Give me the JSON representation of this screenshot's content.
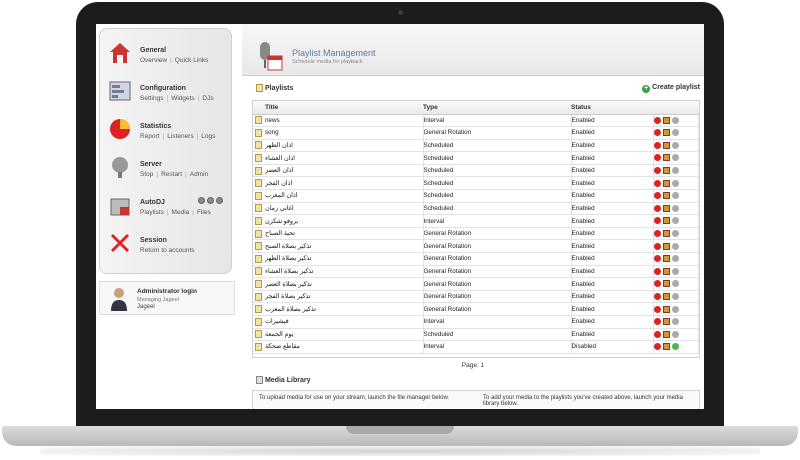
{
  "sidebar": {
    "items": [
      {
        "title": "General",
        "links": [
          "Overview",
          "Quick Links"
        ],
        "icon": "house-icon"
      },
      {
        "title": "Configuration",
        "links": [
          "Settings",
          "Widgets",
          "DJs"
        ],
        "icon": "config-panel-icon"
      },
      {
        "title": "Statistics",
        "links": [
          "Report",
          "Listeners",
          "Logs"
        ],
        "icon": "pie-chart-icon"
      },
      {
        "title": "Server",
        "links": [
          "Stop",
          "Restart",
          "Admin"
        ],
        "icon": "server-icon"
      },
      {
        "title": "AutoDJ",
        "links": [
          "Playlists",
          "Media",
          "Files"
        ],
        "icon": "autodj-icon"
      },
      {
        "title": "Session",
        "links": [
          "Return to accounts"
        ],
        "icon": "close-x-icon"
      }
    ]
  },
  "admin": {
    "title": "Administrator login",
    "subtitle": "Managing Jageel",
    "name": "Jageel"
  },
  "header": {
    "title": "Playlist Management",
    "subtitle": "Schedule media for playback"
  },
  "playlists": {
    "section_title": "Playlists",
    "create_label": "Create playlist",
    "columns": {
      "title": "Title",
      "type": "Type",
      "status": "Status"
    },
    "rows": [
      {
        "title": "news",
        "type": "Interval",
        "status": "Enabled"
      },
      {
        "title": "song",
        "type": "General Rotation",
        "status": "Enabled"
      },
      {
        "title": "اذان الظهر",
        "type": "Scheduled",
        "status": "Enabled"
      },
      {
        "title": "اذان العشاء",
        "type": "Scheduled",
        "status": "Enabled"
      },
      {
        "title": "اذان العصر",
        "type": "Scheduled",
        "status": "Enabled"
      },
      {
        "title": "اذان الفجر",
        "type": "Scheduled",
        "status": "Enabled"
      },
      {
        "title": "اذان المغرب",
        "type": "Scheduled",
        "status": "Enabled"
      },
      {
        "title": "اغاني زمان",
        "type": "Scheduled",
        "status": "Enabled"
      },
      {
        "title": "بروفو شكرن",
        "type": "Interval",
        "status": "Enabled"
      },
      {
        "title": "تحية الصباح",
        "type": "General Rotation",
        "status": "Enabled"
      },
      {
        "title": "تذكير بصلاة الصبح",
        "type": "General Rotation",
        "status": "Enabled"
      },
      {
        "title": "تذكير بصلاة الظهر",
        "type": "General Rotation",
        "status": "Enabled"
      },
      {
        "title": "تذكير بصلاة العشاء",
        "type": "General Rotation",
        "status": "Enabled"
      },
      {
        "title": "تذكير بصلاة العصر",
        "type": "General Rotation",
        "status": "Enabled"
      },
      {
        "title": "تذكير بصلاة الفجر",
        "type": "General Rotation",
        "status": "Enabled"
      },
      {
        "title": "تذكير بصلاة المغرب",
        "type": "General Rotation",
        "status": "Enabled"
      },
      {
        "title": "فيشيرات",
        "type": "Interval",
        "status": "Enabled"
      },
      {
        "title": "يوم الجمعة",
        "type": "Scheduled",
        "status": "Enabled"
      },
      {
        "title": "مقاطع ضحكة",
        "type": "Interval",
        "status": "Disabled"
      }
    ]
  },
  "pager": {
    "label": "Page: 1"
  },
  "media_library": {
    "title": "Media Library",
    "left_text": "To upload media for use on your stream, launch the file manager below.",
    "right_text": "To add your media to the playlists you've created above, launch your media library below."
  },
  "colors": {
    "accent": "#5a7ca2",
    "delete": "#dd2222",
    "enable": "#44bb44"
  }
}
